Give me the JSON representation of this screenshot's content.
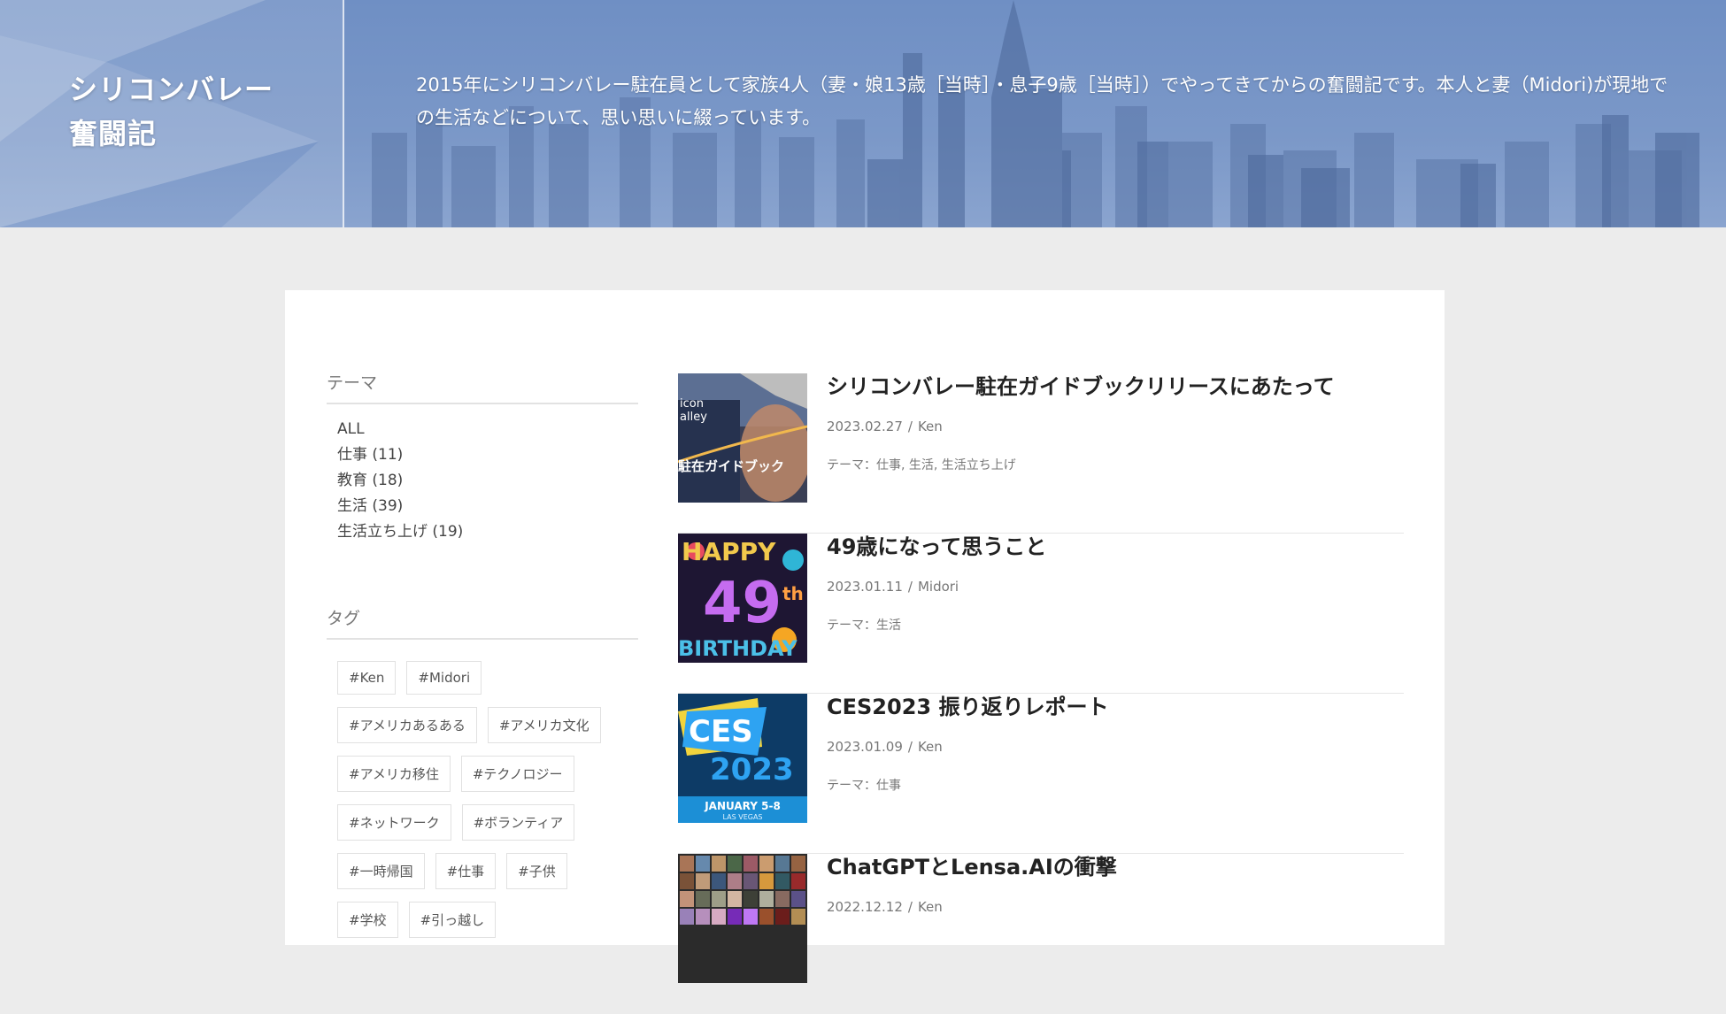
{
  "site": {
    "title_line1": "シリコンバレー",
    "title_line2": "奮闘記",
    "description": "2015年にシリコンバレー駐在員として家族4人（妻・娘13歳［当時］・息子9歳［当時］）でやってきてからの奮闘記です。本人と妻（Midori)が現地での生活などについて、思い思いに綴っています。"
  },
  "sidebar": {
    "theme_title": "テーマ",
    "themes": [
      "ALL",
      "仕事 (11)",
      "教育 (18)",
      "生活 (39)",
      "生活立ち上げ (19)"
    ],
    "tag_title": "タグ",
    "tags": [
      "#Ken",
      "#Midori",
      "#アメリカあるある",
      "#アメリカ文化",
      "#アメリカ移住",
      "#テクノロジー",
      "#ネットワーク",
      "#ボランティア",
      "#一時帰国",
      "#仕事",
      "#子供",
      "#学校",
      "#引っ越し"
    ]
  },
  "posts": [
    {
      "title": "シリコンバレー駐在ガイドブックリリースにあたって",
      "date": "2023.02.27",
      "author": "Ken",
      "theme": "テーマ：仕事, 生活, 生活立ち上げ",
      "thumb_text": [
        "icon",
        "alley",
        "駐在ガイドブック"
      ]
    },
    {
      "title": "49歳になって思うこと",
      "date": "2023.01.11",
      "author": "Midori",
      "theme": "テーマ：生活",
      "thumb_text": [
        "HAPPY",
        "49",
        "th",
        "BIRTHDAY"
      ]
    },
    {
      "title": "CES2023 振り返りレポート",
      "date": "2023.01.09",
      "author": "Ken",
      "theme": "テーマ：仕事",
      "thumb_text": [
        "CES",
        "2023",
        "JANUARY 5-8",
        "LAS VEGAS"
      ]
    },
    {
      "title": "ChatGPTとLensa.AIの衝撃",
      "date": "2022.12.12",
      "author": "Ken",
      "theme": "",
      "thumb_text": []
    }
  ],
  "meta_separator": "/",
  "colors": {
    "header_blue": "#7b98c8",
    "page_bg": "#ececec",
    "ces_blue": "#1c8fd6"
  }
}
